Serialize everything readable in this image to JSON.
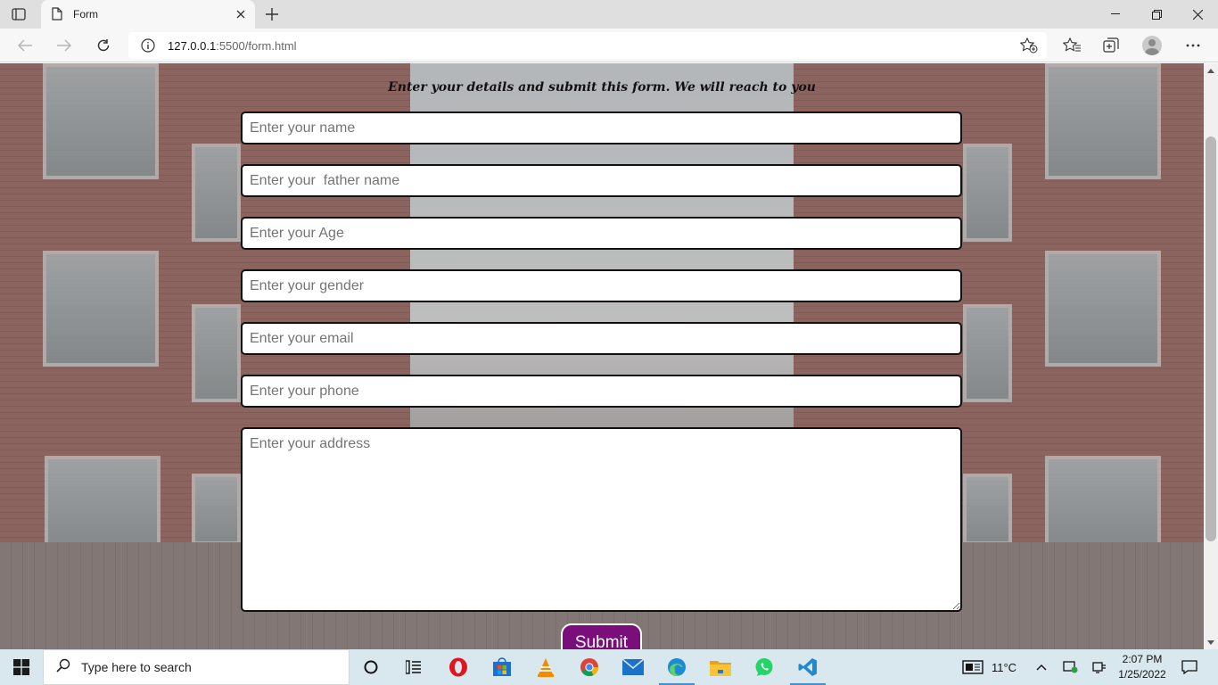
{
  "browser": {
    "tab_title": "Form",
    "url_host": "127.0.0.1",
    "url_path": ":5500/form.html"
  },
  "form": {
    "subtitle": "Enter your details and submit this form. We will reach to you",
    "name_placeholder": "Enter your name",
    "father_placeholder": "Enter your  father name",
    "age_placeholder": "Enter your Age",
    "gender_placeholder": "Enter your gender",
    "email_placeholder": "Enter your email",
    "phone_placeholder": "Enter your phone",
    "address_placeholder": "Enter your address",
    "submit_label": "Submit",
    "submit_color": "#7a0e7a"
  },
  "taskbar": {
    "search_placeholder": "Type here to search",
    "apps": [
      "task-view-icon",
      "widgets-icon",
      "opera-icon",
      "store-icon",
      "vlc-icon",
      "chrome-icon",
      "mail-icon",
      "edge-icon",
      "file-explorer-icon",
      "whatsapp-icon",
      "vscode-icon"
    ],
    "weather": "11°C",
    "time": "2:07 PM",
    "date": "1/25/2022"
  }
}
